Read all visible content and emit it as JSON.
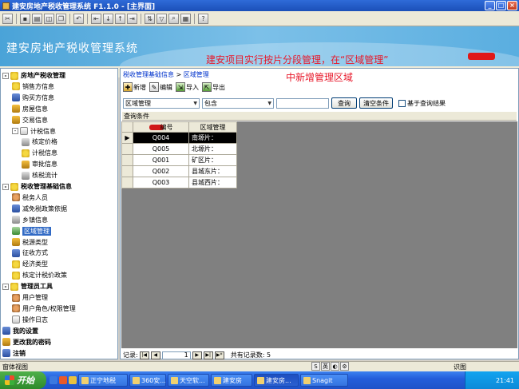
{
  "window": {
    "title": "建安房地产税收管理系统 F1.1.0 - [主界面]",
    "buttons": [
      "_",
      "□",
      "×"
    ]
  },
  "toolbar": {
    "icons": [
      "cut-icon",
      "save-icon",
      "print-icon",
      "preview-icon",
      "copy-icon",
      "undo-icon",
      "first-icon",
      "prev-icon",
      "next-icon",
      "last-icon",
      "sort-icon",
      "filter-icon",
      "find-icon",
      "view-icon",
      "help-icon"
    ]
  },
  "banner": {
    "brand": "建安房地产税收管理系统",
    "annotation": "建安项目实行按片分段管理，在“区域管理”",
    "annotation_color": "#e8182a"
  },
  "strip": {
    "about": "关于"
  },
  "annotation2": "中新增管理区域",
  "sidebar": {
    "items": [
      {
        "label": "房地产税收管理",
        "icon": "folder-icon",
        "bold": true,
        "exp": "-"
      },
      {
        "label": "销售方信息",
        "icon": "star-icon"
      },
      {
        "label": "购买方信息",
        "icon": "book-icon"
      },
      {
        "label": "房屋信息",
        "icon": "key-icon"
      },
      {
        "label": "交易信息",
        "icon": "search-icon"
      },
      {
        "label": "计税信息",
        "icon": "doc-icon",
        "exp": "-"
      },
      {
        "label": "核定价格",
        "icon": "pen-icon"
      },
      {
        "label": "计税信息",
        "icon": "star-icon"
      },
      {
        "label": "审批信息",
        "icon": "search-icon"
      },
      {
        "label": "核税流计",
        "icon": "pen-icon"
      },
      {
        "label": "税收管理基础信息",
        "icon": "folder-icon",
        "bold": true,
        "exp": "-"
      },
      {
        "label": "税务人员",
        "icon": "user-icon"
      },
      {
        "label": "减免税政策依据",
        "icon": "book-icon"
      },
      {
        "label": "乡镇信息",
        "icon": "pen-icon"
      },
      {
        "label": "区域管理",
        "icon": "grid-icon",
        "selected": true
      },
      {
        "label": "税源类型",
        "icon": "key-icon"
      },
      {
        "label": "征收方式",
        "icon": "book-icon"
      },
      {
        "label": "经济类型",
        "icon": "star-icon"
      },
      {
        "label": "核定计税价政策",
        "icon": "folder-icon"
      },
      {
        "label": "管理员工具",
        "icon": "star-icon",
        "bold": true,
        "exp": "-"
      },
      {
        "label": "用户管理",
        "icon": "user-icon"
      },
      {
        "label": "用户角色/权限管理",
        "icon": "user-icon"
      },
      {
        "label": "操作日志",
        "icon": "doc-icon"
      },
      {
        "label": "我的设置",
        "icon": "book-icon",
        "bold": true
      },
      {
        "label": "更改我的密码",
        "icon": "key-icon",
        "bold": true
      },
      {
        "label": "注销",
        "icon": "book-icon",
        "bold": true
      }
    ]
  },
  "main": {
    "breadcrumb": [
      "税收管理基础信息",
      "区域管理"
    ],
    "breadcrumb_sep": ">",
    "actions": [
      {
        "label": "新增",
        "icon": "new-icon"
      },
      {
        "label": "编辑",
        "icon": "edit-icon"
      },
      {
        "label": "导入",
        "icon": "import-icon"
      },
      {
        "label": "导出",
        "icon": "export-icon"
      }
    ],
    "filter": {
      "field": "区域管理",
      "op": "包含",
      "value": "",
      "query_btn": "查询",
      "clear_btn": "清空条件",
      "checkbox_label": "基于查询结果"
    },
    "cond_label": "查询条件",
    "grid": {
      "columns": [
        "编号",
        "区域管理"
      ],
      "rows": [
        {
          "code": "Q004",
          "name": "南塬片：",
          "selected": true,
          "marker": "▶"
        },
        {
          "code": "Q005",
          "name": "北塬片："
        },
        {
          "code": "Q001",
          "name": "矿区片："
        },
        {
          "code": "Q002",
          "name": "县城东片："
        },
        {
          "code": "Q003",
          "name": "县城西片："
        }
      ]
    },
    "nav": {
      "label": "记录:",
      "page": "1",
      "total": "共有记录数: 5"
    }
  },
  "status": {
    "left": "窗体视图",
    "right": "识图"
  },
  "taskbar": {
    "start": "开始",
    "tasks": [
      "正宁地税",
      "360安...",
      "天空软...",
      "建安房",
      "建安房...",
      "Snagit"
    ],
    "clock": "21:41"
  }
}
